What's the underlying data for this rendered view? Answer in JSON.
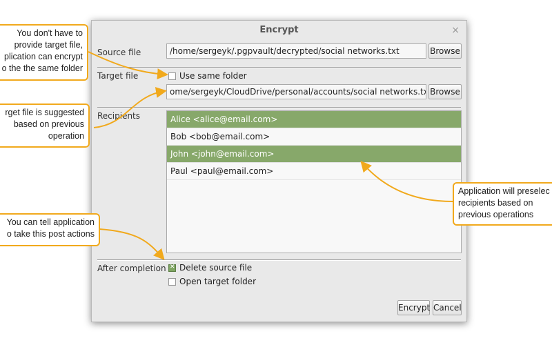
{
  "dialog": {
    "title": "Encrypt",
    "close_glyph": "×",
    "source_file_label": "Source file",
    "source_file_value": "/home/sergeyk/.pgpvault/decrypted/social networks.txt",
    "browse_label": "Browse",
    "target_file_label": "Target file",
    "use_same_folder_label": "Use same folder",
    "use_same_folder_checked": false,
    "target_file_value": "ome/sergeyk/CloudDrive/personal/accounts/social networks.txt.pgp",
    "recipients_label": "Recipients",
    "recipients": [
      {
        "text": "Alice <alice@email.com>",
        "selected": true
      },
      {
        "text": "Bob <bob@email.com>",
        "selected": false
      },
      {
        "text": "John <john@email.com>",
        "selected": true
      },
      {
        "text": "Paul <paul@email.com>",
        "selected": false
      }
    ],
    "after_completion_label": "After completion",
    "delete_source_label": "Delete source file",
    "delete_source_checked": true,
    "open_target_label": "Open target folder",
    "open_target_checked": false,
    "encrypt_label": "Encrypt",
    "cancel_label": "Cancel"
  },
  "callouts": {
    "target_optional": [
      "You don't have to",
      "provide target file,",
      "plication can encrypt",
      "o the the same folder"
    ],
    "target_suggested": [
      "rget file is suggested",
      "based on previous",
      "operation"
    ],
    "post_actions": [
      "You can tell application",
      "o take this post actions"
    ],
    "preselect": [
      "Application will preselec",
      "recipients based on",
      "previous operations"
    ]
  },
  "colors": {
    "accent": "#f1a91c",
    "selection": "#87a86a"
  }
}
